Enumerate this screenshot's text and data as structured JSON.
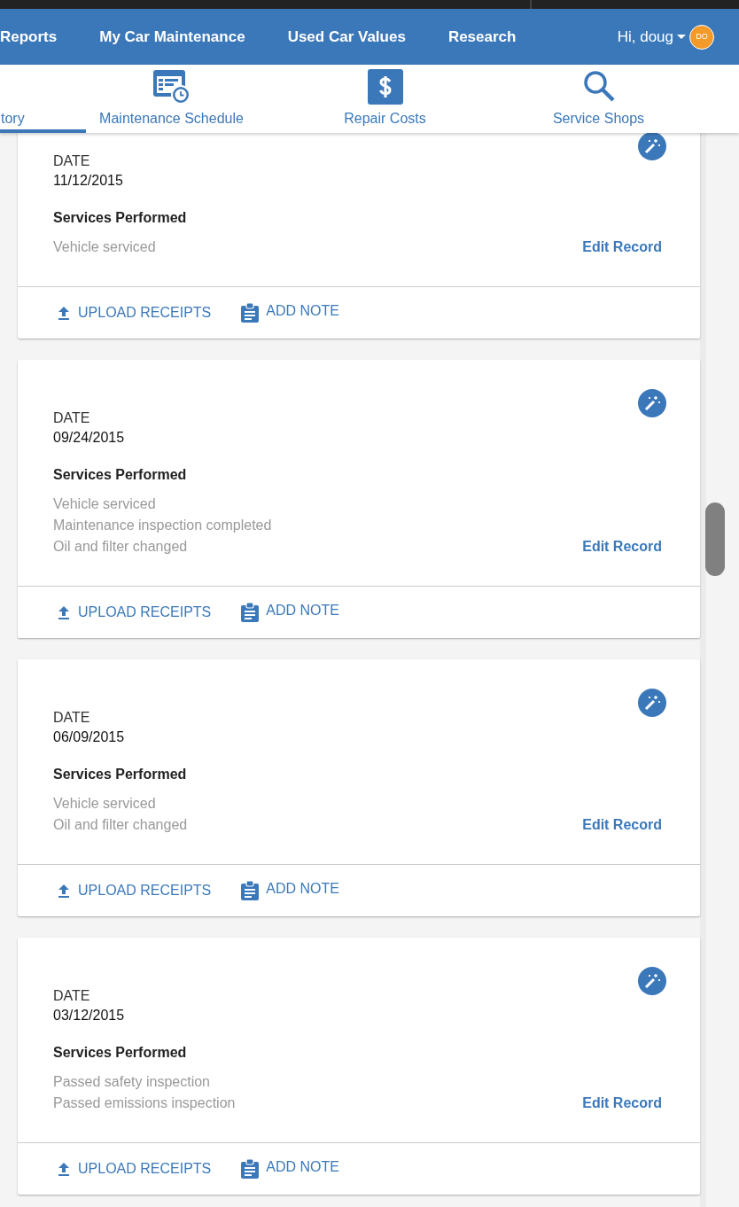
{
  "top_nav": {
    "items": [
      {
        "label": "Reports"
      },
      {
        "label": "My Car Maintenance"
      },
      {
        "label": "Used Car Values"
      },
      {
        "label": "Research"
      }
    ],
    "user": {
      "greeting": "Hi, doug",
      "initials": "DO"
    }
  },
  "tabs": [
    {
      "label": "tory",
      "selected": true,
      "kind": "none"
    },
    {
      "label": "Maintenance Schedule",
      "selected": false,
      "kind": "schedule"
    },
    {
      "label": "Repair Costs",
      "selected": false,
      "kind": "dollar"
    },
    {
      "label": "Service Shops",
      "selected": false,
      "kind": "search"
    }
  ],
  "records": [
    {
      "date_label": "DATE",
      "date": "11/12/2015",
      "services_heading": "Services Performed",
      "services": [
        "Vehicle serviced"
      ],
      "edit_link": "Edit Record",
      "actions": [
        {
          "kind": "upload",
          "label": "UPLOAD RECEIPTS"
        },
        {
          "kind": "note",
          "label": "ADD NOTE"
        }
      ]
    },
    {
      "date_label": "DATE",
      "date": "09/24/2015",
      "services_heading": "Services Performed",
      "services": [
        "Vehicle serviced",
        "Maintenance inspection completed",
        "Oil and filter changed"
      ],
      "edit_link": "Edit Record",
      "actions": [
        {
          "kind": "upload",
          "label": "UPLOAD RECEIPTS"
        },
        {
          "kind": "note",
          "label": "ADD NOTE"
        }
      ]
    },
    {
      "date_label": "DATE",
      "date": "06/09/2015",
      "services_heading": "Services Performed",
      "services": [
        "Vehicle serviced",
        "Oil and filter changed"
      ],
      "edit_link": "Edit Record",
      "actions": [
        {
          "kind": "upload",
          "label": "UPLOAD RECEIPTS"
        },
        {
          "kind": "note",
          "label": "ADD NOTE"
        }
      ]
    },
    {
      "date_label": "DATE",
      "date": "03/12/2015",
      "services_heading": "Services Performed",
      "services": [
        "Passed safety inspection",
        "Passed emissions inspection"
      ],
      "edit_link": "Edit Record",
      "actions": [
        {
          "kind": "upload",
          "label": "UPLOAD RECEIPTS"
        },
        {
          "kind": "note",
          "label": "ADD NOTE"
        }
      ]
    }
  ]
}
